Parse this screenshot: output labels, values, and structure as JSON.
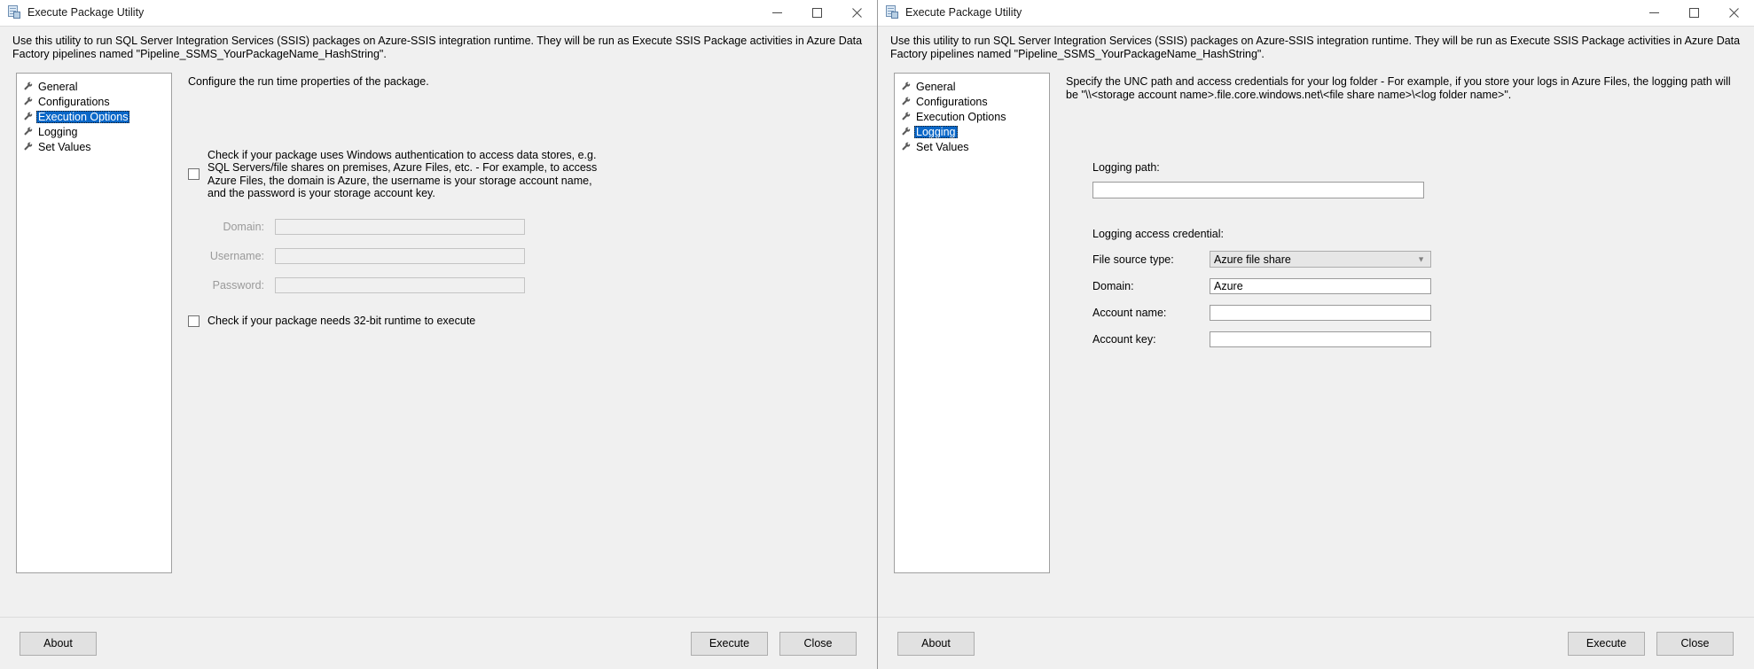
{
  "windows": [
    {
      "title": "Execute Package Utility",
      "intro": "Use this utility to run SQL Server Integration Services (SSIS) packages on Azure-SSIS integration runtime. They will be run as Execute SSIS Package activities in Azure Data Factory pipelines named \"Pipeline_SSMS_YourPackageName_HashString\".",
      "tree": [
        {
          "label": "General",
          "selected": false
        },
        {
          "label": "Configurations",
          "selected": false
        },
        {
          "label": "Execution Options",
          "selected": true
        },
        {
          "label": "Logging",
          "selected": false
        },
        {
          "label": "Set Values",
          "selected": false
        }
      ],
      "pane": "execution-options",
      "detail_heading": "Configure the run time properties of the package.",
      "windows_auth": {
        "checked": false,
        "description": "Check if your package uses Windows authentication to access data stores, e.g. SQL Servers/file shares on premises, Azure Files, etc. - For example, to access Azure Files, the domain is Azure, the username is your storage account name, and the password is your storage account key."
      },
      "credential_fields": [
        {
          "label": "Domain:",
          "value": "",
          "enabled": false
        },
        {
          "label": "Username:",
          "value": "",
          "enabled": false
        },
        {
          "label": "Password:",
          "value": "",
          "enabled": false
        }
      ],
      "runtime_check": {
        "label": "Check if your package needs 32-bit runtime to execute",
        "checked": false
      },
      "footer": {
        "about": "About",
        "execute": "Execute",
        "close": "Close"
      },
      "caption": {
        "minimize": "minimize-icon",
        "maximize": "maximize-icon",
        "close": "close-icon"
      }
    },
    {
      "title": "Execute Package Utility",
      "intro": "Use this utility to run SQL Server Integration Services (SSIS) packages on Azure-SSIS integration runtime. They will be run as Execute SSIS Package activities in Azure Data Factory pipelines named \"Pipeline_SSMS_YourPackageName_HashString\".",
      "tree": [
        {
          "label": "General",
          "selected": false
        },
        {
          "label": "Configurations",
          "selected": false
        },
        {
          "label": "Execution Options",
          "selected": false
        },
        {
          "label": "Logging",
          "selected": true
        },
        {
          "label": "Set Values",
          "selected": false
        }
      ],
      "pane": "logging",
      "detail_heading": "Specify the UNC path and access credentials for your log folder - For example, if you store your logs in Azure Files, the logging path will be \"\\\\<storage account name>.file.core.windows.net\\<file share name>\\<log folder name>\".",
      "logging": {
        "path_label": "Logging path:",
        "path_value": "",
        "credential_label": "Logging access credential:",
        "fields": [
          {
            "label": "File source type:",
            "value": "Azure file share",
            "type": "combobox"
          },
          {
            "label": "Domain:",
            "value": "Azure",
            "type": "text"
          },
          {
            "label": "Account name:",
            "value": "",
            "type": "text"
          },
          {
            "label": "Account key:",
            "value": "",
            "type": "text"
          }
        ],
        "file_source_options": [
          "Azure file share"
        ]
      },
      "footer": {
        "about": "About",
        "execute": "Execute",
        "close": "Close"
      },
      "caption": {
        "minimize": "minimize-icon",
        "maximize": "maximize-icon",
        "close": "close-icon"
      }
    }
  ],
  "colors": {
    "selection_blue": "#0a67c8",
    "dialog_face": "#f0f0f0",
    "button_face": "#e1e1e1",
    "field_white": "#ffffff"
  }
}
